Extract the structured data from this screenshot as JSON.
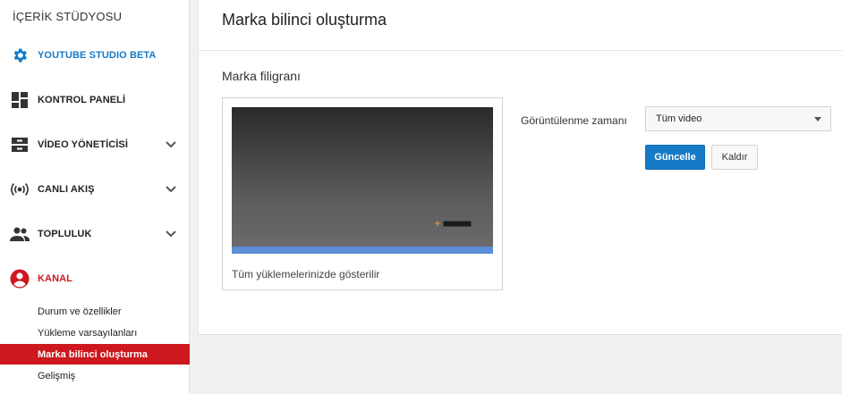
{
  "sidebar": {
    "title": "İÇERİK STÜDYOSU",
    "items": [
      {
        "label": "YOUTUBE STUDIO BETA",
        "icon": "gear-icon",
        "color": "#167ac6"
      },
      {
        "label": "KONTROL PANELİ",
        "icon": "dashboard-icon"
      },
      {
        "label": "VİDEO YÖNETİCİSİ",
        "icon": "video-manager-icon",
        "expandable": true
      },
      {
        "label": "CANLI AKIŞ",
        "icon": "live-broadcast-icon",
        "expandable": true
      },
      {
        "label": "TOPLULUK",
        "icon": "community-icon",
        "expandable": true
      },
      {
        "label": "KANAL",
        "icon": "account-circle-icon",
        "color": "#cc181e"
      }
    ],
    "sub_items": [
      {
        "label": "Durum ve özellikler"
      },
      {
        "label": "Yükleme varsayılanları"
      },
      {
        "label": "Marka bilinci oluşturma",
        "active": true
      },
      {
        "label": "Gelişmiş"
      }
    ]
  },
  "main": {
    "page_title": "Marka bilinci oluşturma",
    "section_title": "Marka filigranı",
    "preview": {
      "caption": "Tüm yüklemelerinizde gösterilir"
    },
    "display_time": {
      "label": "Görüntülenme zamanı",
      "selected": "Tüm video"
    },
    "buttons": {
      "update": "Güncelle",
      "remove": "Kaldır"
    }
  },
  "colors": {
    "accent_blue": "#167ac6",
    "brand_red": "#cc181e"
  }
}
